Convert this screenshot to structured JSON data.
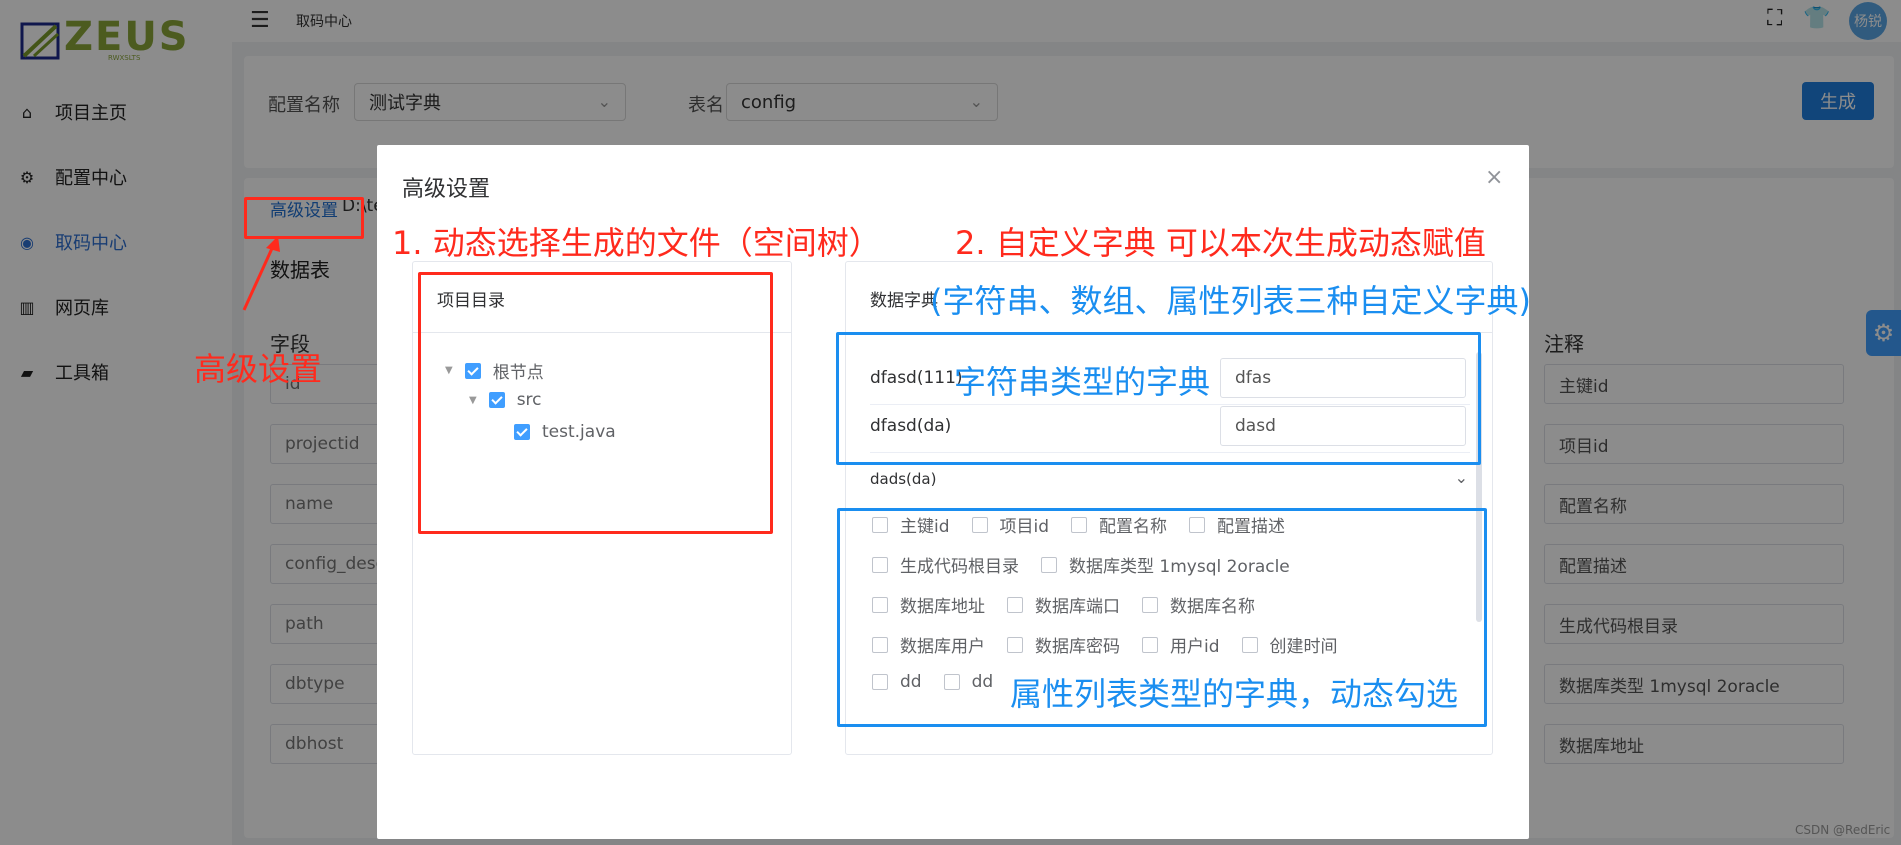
{
  "sidebar": {
    "logo_text": "ZEUS",
    "logo_sub": "RWXSLTS",
    "items": [
      {
        "label": "项目主页",
        "icon": "home-icon"
      },
      {
        "label": "配置中心",
        "icon": "gear-icon"
      },
      {
        "label": "取码中心",
        "icon": "target-icon"
      },
      {
        "label": "网页库",
        "icon": "books-icon"
      },
      {
        "label": "工具箱",
        "icon": "toolbox-icon"
      }
    ]
  },
  "topbar": {
    "title": "取码中心",
    "avatar_text": "杨锐"
  },
  "form": {
    "config_label": "配置名称",
    "config_value": "测试字典",
    "table_label": "表名",
    "table_value": "config",
    "generate_label": "生成"
  },
  "advanced": {
    "link_label": "高级设置",
    "path_prefix": "D:\\te"
  },
  "table": {
    "section_title": "数据表",
    "field_header": "字段",
    "comment_header": "注释",
    "fields": [
      "id",
      "projectid",
      "name",
      "config_desc",
      "path",
      "dbtype",
      "dbhost"
    ],
    "comments": [
      "主键id",
      "项目id",
      "配置名称",
      "配置描述",
      "生成代码根目录",
      "数据库类型 1mysql 2oracle",
      "数据库地址"
    ]
  },
  "dialog": {
    "title": "高级设置",
    "left_title": "项目目录",
    "tree": [
      {
        "label": "根节点",
        "level": 0,
        "checked": true,
        "expandable": true
      },
      {
        "label": "src",
        "level": 1,
        "checked": true,
        "expandable": true
      },
      {
        "label": "test.java",
        "level": 2,
        "checked": true,
        "expandable": false
      }
    ],
    "right_title": "数据字典",
    "dict_rows": [
      {
        "key": "dfasd(111)",
        "value": "dfas"
      },
      {
        "key": "dfasd(da)",
        "value": "dasd"
      }
    ],
    "collapse_label": "dads(da)",
    "checkbox_rows": [
      [
        "主键id",
        "项目id",
        "配置名称",
        "配置描述"
      ],
      [
        "生成代码根目录",
        "数据库类型 1mysql 2oracle"
      ],
      [
        "数据库地址",
        "数据库端口",
        "数据库名称"
      ],
      [
        "数据库用户",
        "数据库密码",
        "用户id",
        "创建时间"
      ],
      [
        "dd",
        "dd"
      ]
    ]
  },
  "annotations": {
    "a1": "1. 动态选择生成的文件（空间树）",
    "a2": "2. 自定义字典 可以本次生成动态赋值",
    "a3": "(字符串、数组、属性列表三种自定义字典)",
    "a4": "字符串类型的字典",
    "a5": "属性列表类型的字典，动态勾选",
    "a6": "高级设置"
  },
  "watermark": "CSDN @RedEric",
  "colors": {
    "primary": "#409eff",
    "button": "#1f7fde",
    "annotation_red": "#ff2a1d",
    "annotation_blue": "#1a8ef0"
  }
}
